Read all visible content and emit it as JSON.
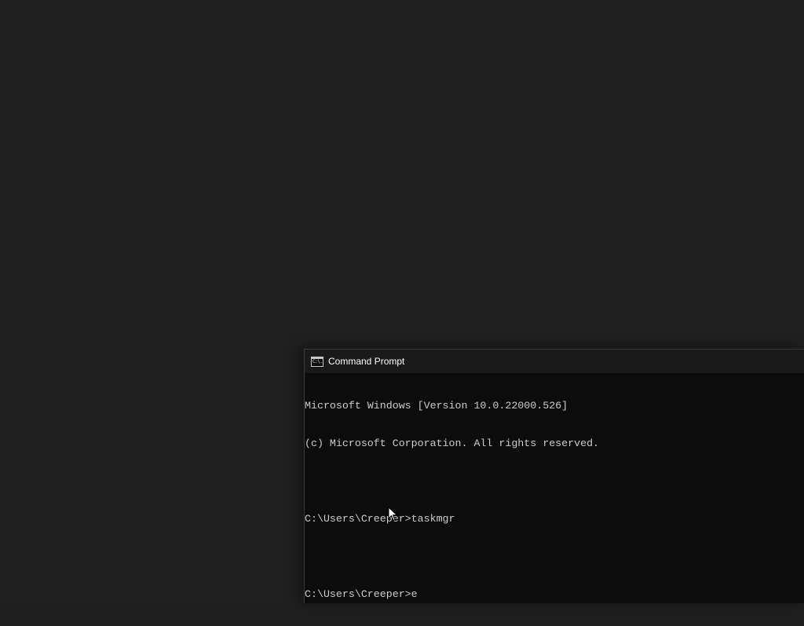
{
  "window": {
    "title": "Command Prompt",
    "icon": "cmd-icon",
    "icon_text": "C:\\."
  },
  "console": {
    "lines": [
      "Microsoft Windows [Version 10.0.22000.526]",
      "(c) Microsoft Corporation. All rights reserved.",
      "",
      "C:\\Users\\Creeper>taskmgr",
      "",
      "C:\\Users\\Creeper>e"
    ]
  },
  "colors": {
    "console_bg": "#0c0c0c",
    "console_text": "#cccccc",
    "desktop_bg": "#202020"
  }
}
